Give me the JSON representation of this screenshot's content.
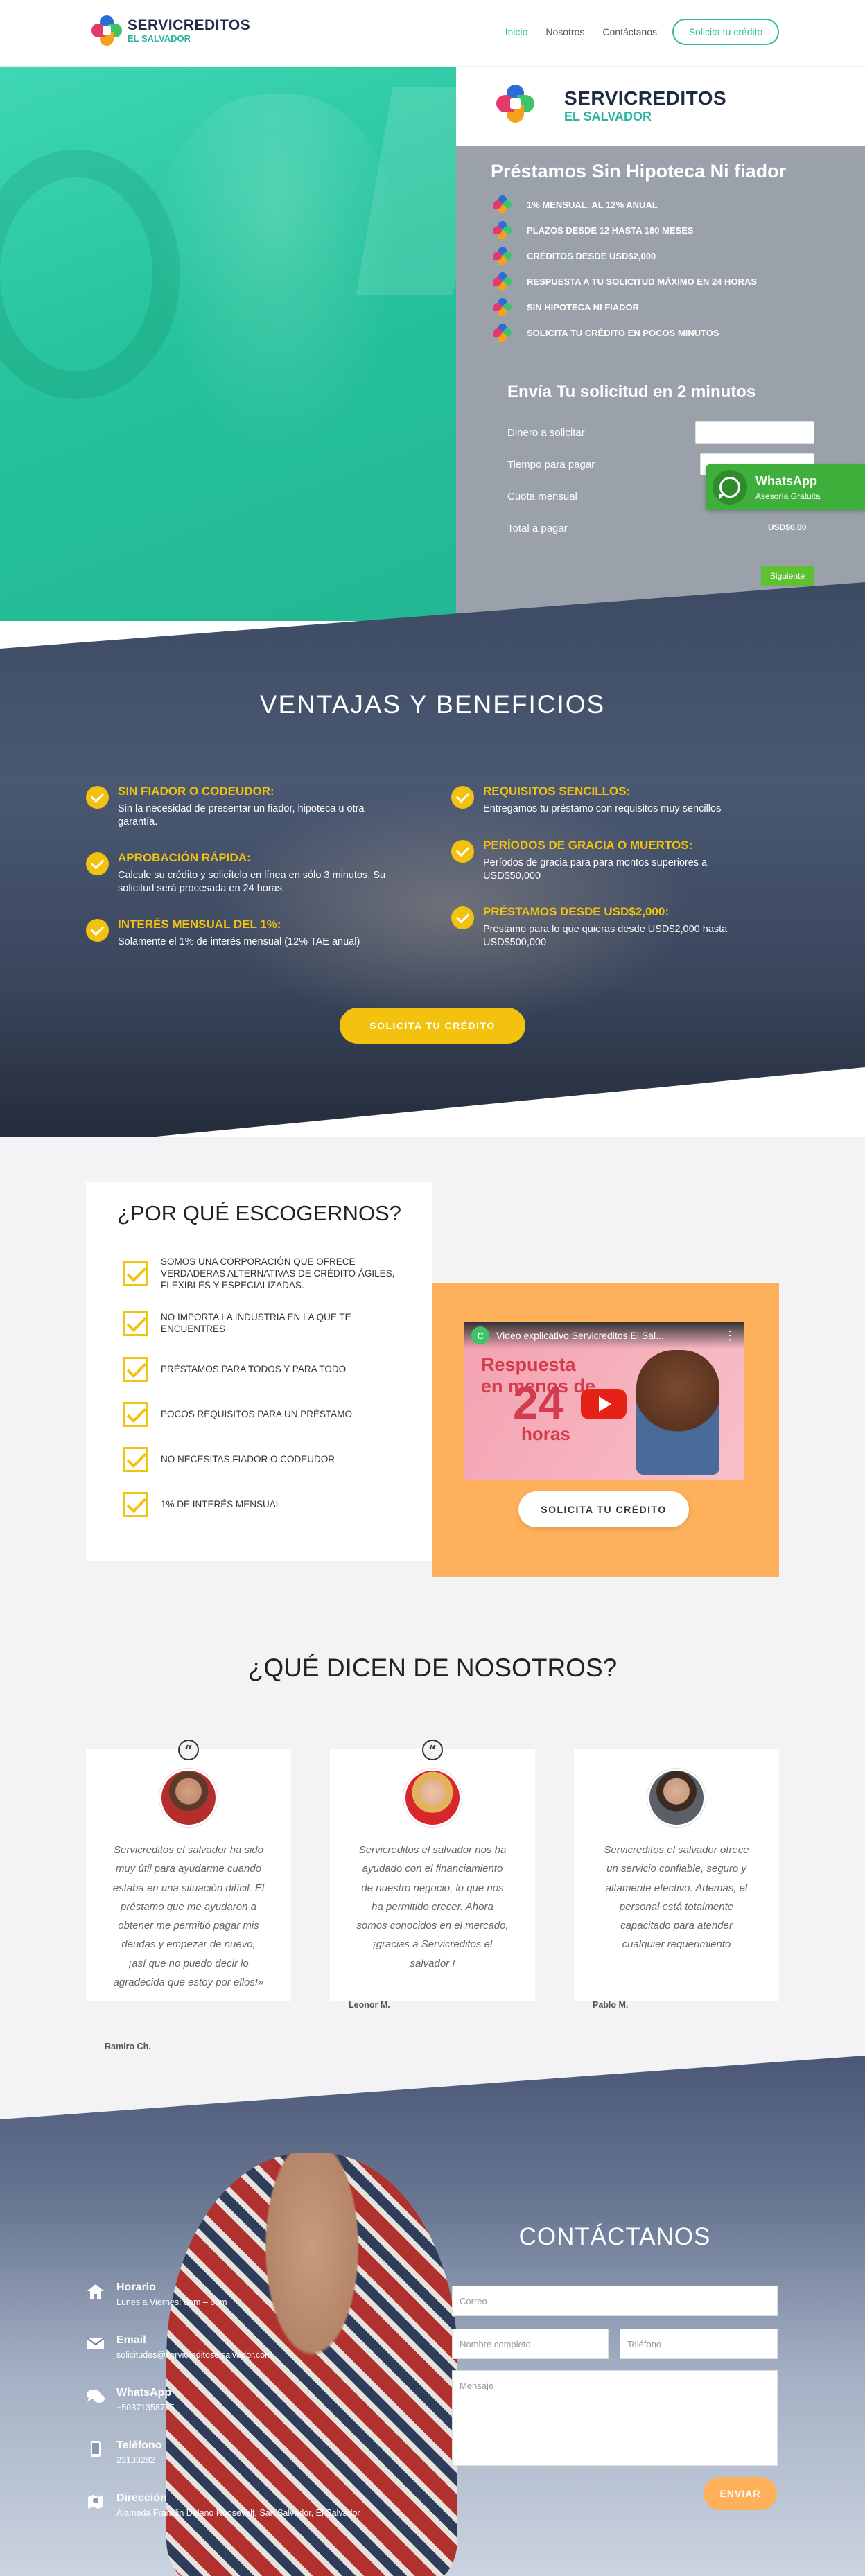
{
  "header": {
    "logo_line1": "SERVICREDITOS",
    "logo_line2": "EL SALVADOR",
    "nav": [
      "Inicio",
      "Nosotros",
      "Contáctanos"
    ],
    "cta": "Solicita tu crédito"
  },
  "hero": {
    "logo_line1": "SERVICREDITOS",
    "logo_line2": "EL SALVADOR",
    "title": "Préstamos Sin Hipoteca Ni fiador",
    "features": [
      "1% MENSUAL, AL 12% ANUAL",
      "PLAZOS DESDE 12 HASTA 180 MESES",
      "CRÉDITOS DESDE USD$2,000",
      "RESPUESTA A TU SOLICITUD MÁXIMO EN 24 HORAS",
      "SIN HIPOTECA NI FIADOR",
      "SOLICITA TU CRÉDITO EN POCOS MINUTOS"
    ],
    "form_title": "Envía Tu solicitud en 2 minutos",
    "form_labels": [
      "Dinero a solicitar",
      "Tiempo para pagar",
      "Cuota mensual",
      "Total a pagar"
    ],
    "total_value": "USD$0.00",
    "next_button": "Siguiente"
  },
  "whatsapp": {
    "title": "WhatsApp",
    "subtitle": "Asesoría Gratuita"
  },
  "ventajas": {
    "title": "VENTAJAS Y BENEFICIOS",
    "left": [
      {
        "h": "SIN FIADOR O CODEUDOR:",
        "d": "Sin la necesidad de presentar un fiador, hipoteca u otra garantía."
      },
      {
        "h": "APROBACIÓN RÁPIDA:",
        "d": "Calcule su crédito y solicítelo en línea en sólo 3 minutos. Su solicitud será procesada en 24 horas"
      },
      {
        "h": "INTERÉS MENSUAL DEL 1%:",
        "d": "Solamente el 1% de interés mensual (12% TAE anual)"
      }
    ],
    "right": [
      {
        "h": "REQUISITOS SENCILLOS:",
        "d": "Entregamos tu préstamo con requisitos muy sencillos"
      },
      {
        "h": "PERÍODOS DE GRACIA O MUERTOS:",
        "d": "Períodos de gracia para para montos superiores a USD$50,000"
      },
      {
        "h": "PRÉSTAMOS DESDE USD$2,000:",
        "d": "Préstamo para lo que quieras desde USD$2,000 hasta USD$500,000"
      }
    ],
    "cta": "SOLICITA TU CRÉDITO"
  },
  "why": {
    "title": "¿POR QUÉ ESCOGERNOS?",
    "items": [
      "SOMOS UNA CORPORACIÓN QUE OFRECE VERDADERAS ALTERNATIVAS DE CRÉDITO ÁGILES, FLEXIBLES Y ESPECIALIZADAS.",
      "NO IMPORTA LA INDUSTRIA EN LA QUE TE ENCUENTRES",
      "PRÉSTAMOS PARA TODOS Y PARA TODO",
      "POCOS REQUISITOS PARA UN PRÉSTAMO",
      "NO NECESITAS FIADOR O CODEUDOR",
      "1% DE INTERÉS MENSUAL"
    ]
  },
  "video": {
    "channel_initial": "C",
    "title": "Video explicativo Servicreditos El Sal...",
    "thumb_line1": "Respuesta",
    "thumb_line1b": "en menos de",
    "thumb_line2": "24",
    "thumb_line3": "horas",
    "cta": "SOLICITA TU CRÉDITO"
  },
  "testimonials": {
    "title": "¿QUÉ DICEN DE NOSOTROS?",
    "items": [
      {
        "text": "Servicreditos el salvador ha sido muy útil para ayudarme cuando estaba en una situación difícil. El préstamo que me ayudaron a obtener me permitió pagar mis deudas y empezar de nuevo, ¡así que no puedo decir lo agradecida que estoy por ellos!»",
        "name": "Ramiro Ch."
      },
      {
        "text": "Servicreditos el salvador nos ha ayudado con el financiamiento de nuestro negocio, lo que nos ha permitido crecer. Ahora somos conocidos en el mercado, ¡gracias a Servicreditos el salvador !",
        "name": "Leonor M."
      },
      {
        "text": "Servicreditos el salvador ofrece un servicio confiable, seguro y altamente efectivo. Además, el personal está totalmente capacitado para atender cualquier requerimiento",
        "name": "Pablo M."
      }
    ]
  },
  "contact": {
    "title": "CONTÁCTANOS",
    "items": [
      {
        "h": "Horario",
        "d": "Lunes a Viernes: 8am – 6pm",
        "icon": "home-icon"
      },
      {
        "h": "Email",
        "d": "solicitudes@servicreditoselsalvador.com",
        "icon": "mail-icon"
      },
      {
        "h": "WhatsApp",
        "d": "+50371358775",
        "icon": "chat-icon"
      },
      {
        "h": "Teléfono",
        "d": "23133282",
        "icon": "phone-icon"
      },
      {
        "h": "Dirección",
        "d": "Alameda Franklin Delano Roosevelt, San Salvador, El Salvador",
        "icon": "map-icon"
      }
    ],
    "placeholders": {
      "email": "Correo",
      "name": "Nombre completo",
      "phone": "Teléfono",
      "message": "Mensaje"
    },
    "send": "ENVIAR"
  }
}
